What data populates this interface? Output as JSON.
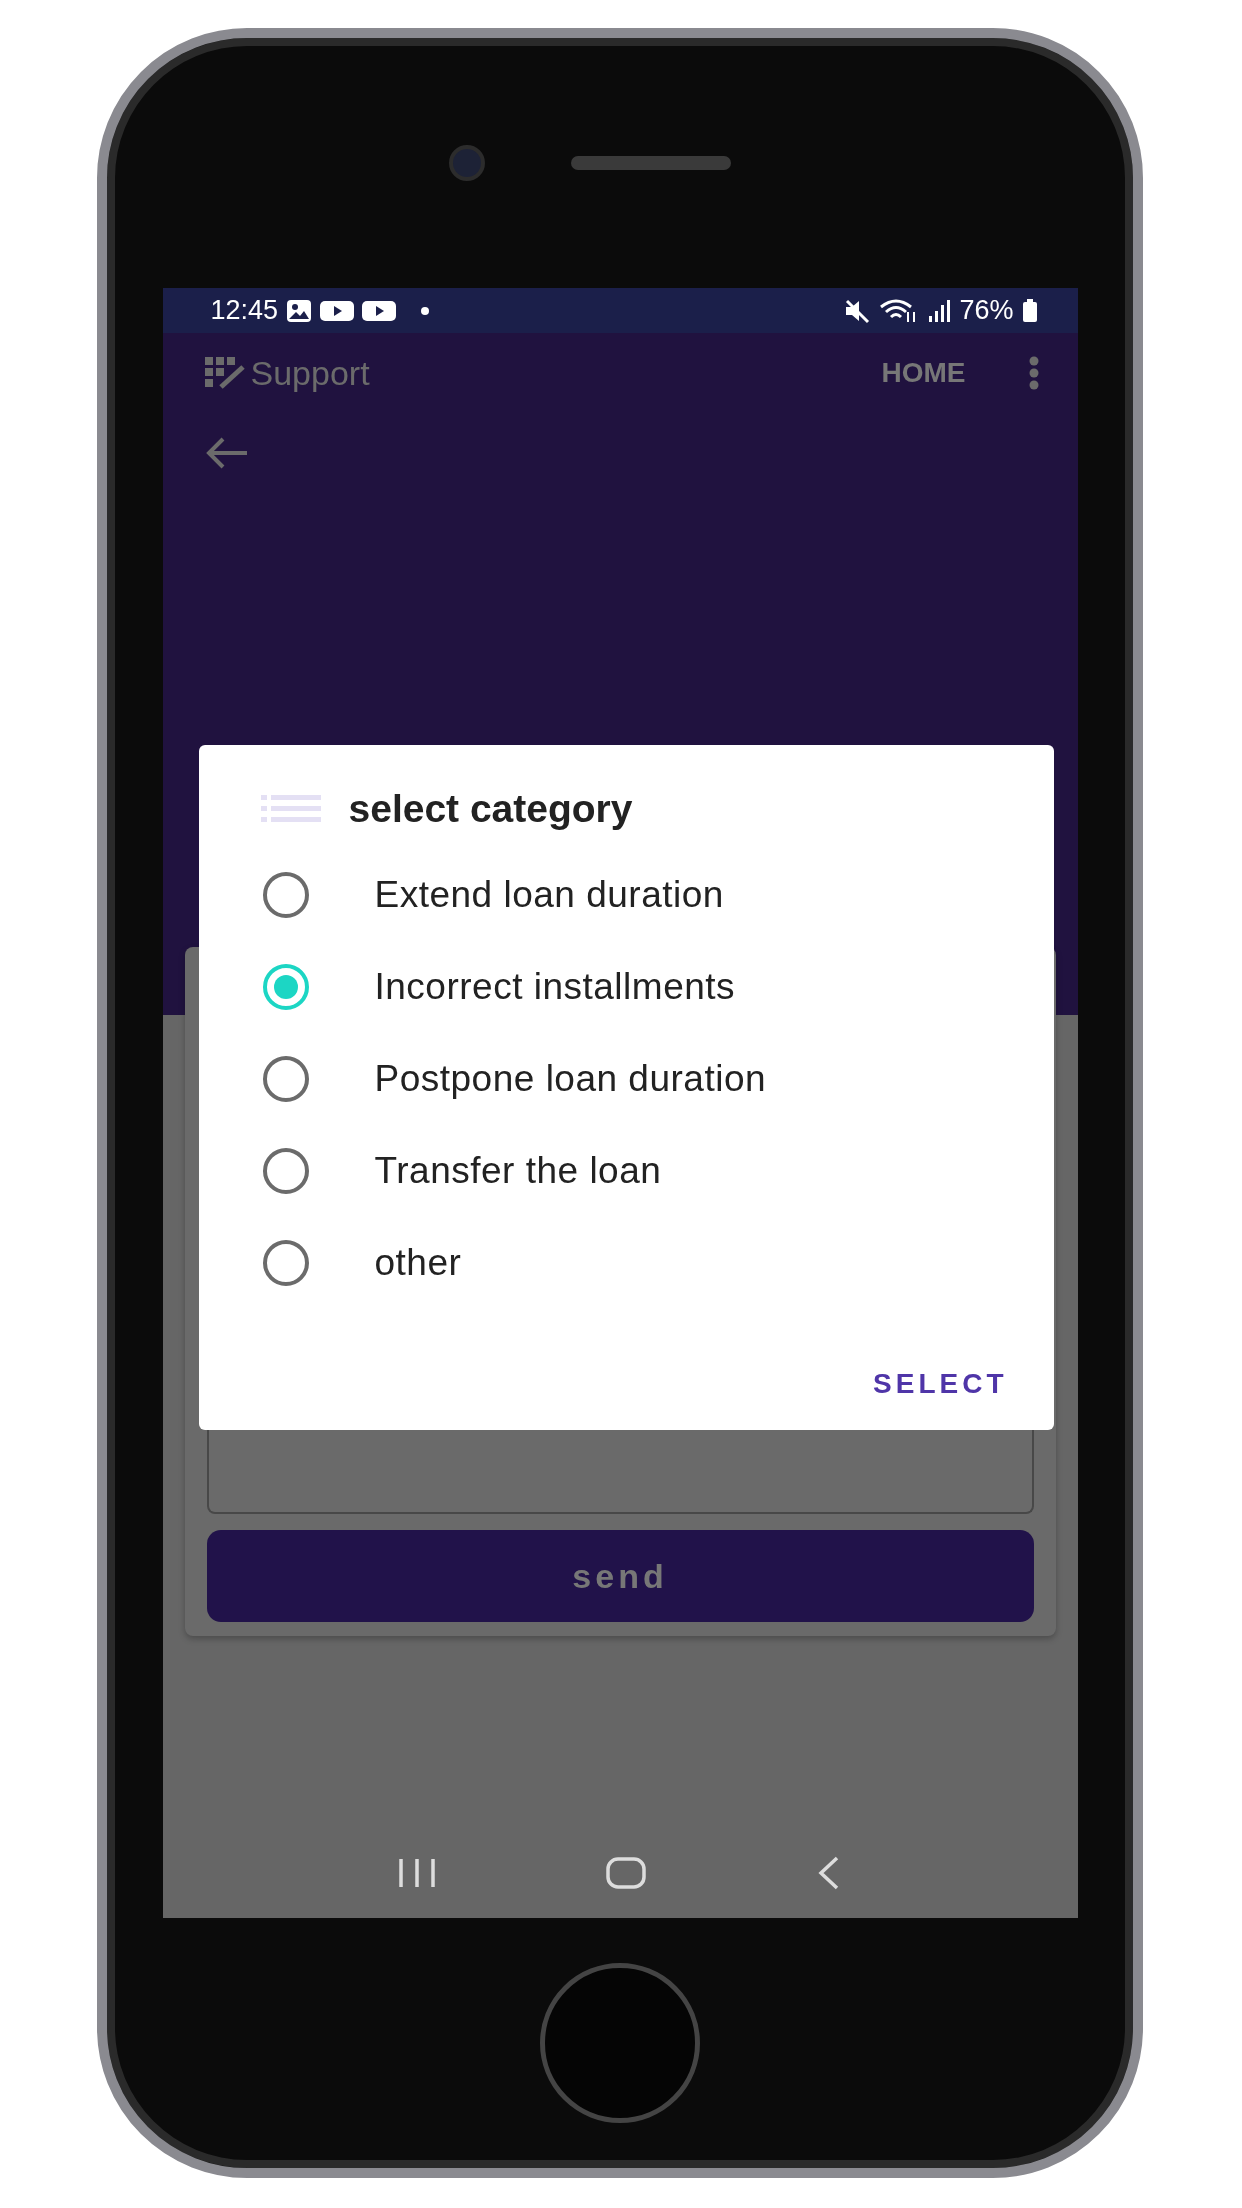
{
  "status_bar": {
    "time": "12:45",
    "battery": "76%"
  },
  "app_bar": {
    "title": "Support",
    "action": "HOME"
  },
  "form": {
    "send_button": "send"
  },
  "dialog": {
    "title": "select category",
    "confirm": "SELECT",
    "options": [
      {
        "label": "Extend loan duration",
        "selected": false
      },
      {
        "label": "Incorrect installments",
        "selected": true
      },
      {
        "label": "Postpone loan duration",
        "selected": false
      },
      {
        "label": "Transfer the loan",
        "selected": false
      },
      {
        "label": "other",
        "selected": false
      }
    ]
  }
}
